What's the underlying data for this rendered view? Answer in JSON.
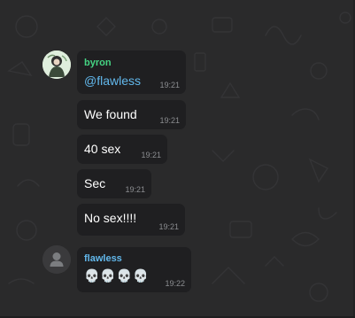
{
  "messages": [
    {
      "sender": "byron",
      "sender_color": "#45d483",
      "text": "@flawless",
      "time": "19:21"
    },
    {
      "text": "We found",
      "time": "19:21"
    },
    {
      "text": "40 sex",
      "time": "19:21"
    },
    {
      "text": "Sec",
      "time": "19:21"
    },
    {
      "text": "No sex!!!!",
      "time": "19:21"
    },
    {
      "sender": "flawless",
      "sender_color": "#62b8ec",
      "text": "💀💀💀💀",
      "time": "19:22"
    }
  ],
  "avatars": [
    {
      "user": "byron",
      "icon": "user-photo-icon"
    },
    {
      "user": "flawless",
      "icon": "default-user-icon"
    }
  ],
  "colors": {
    "background": "#2a2a2b",
    "bubble": "#1f1f21",
    "timestamp": "#8b8d90",
    "mention": "#62b8ec"
  }
}
